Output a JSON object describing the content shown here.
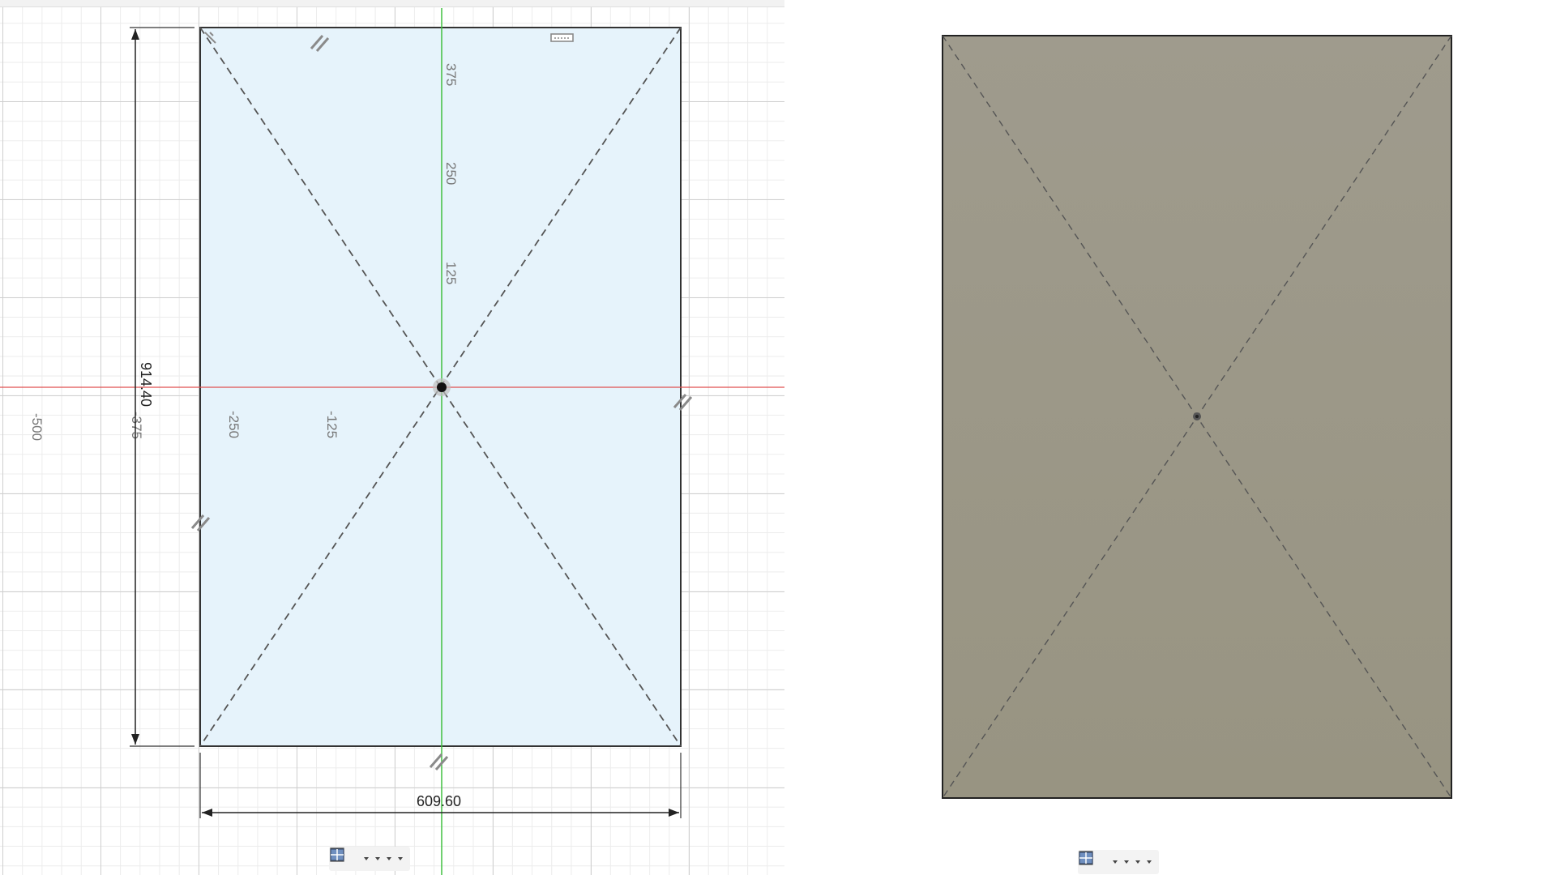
{
  "sketch_view": {
    "axis_labels": {
      "x": [
        "-500",
        "-375",
        "-250",
        "-125"
      ],
      "y": [
        "375",
        "250",
        "125"
      ]
    },
    "dimensions": {
      "height": "914.40",
      "width": "609.60"
    },
    "colors": {
      "x_axis": "#e05050",
      "y_axis": "#40c040",
      "profile_fill": "#e6f3fb"
    }
  },
  "render_view": {
    "colors": {
      "body_fill": "#9c988a"
    }
  },
  "toolbars": [
    {
      "id": "left",
      "buttons": [
        {
          "icon": "orbit-icon",
          "dropdown": true
        },
        {
          "icon": "look-at-icon",
          "dropdown": false
        },
        {
          "icon": "pan-hand-icon",
          "dropdown": false
        },
        {
          "icon": "zoom-icon",
          "dropdown": false
        },
        {
          "icon": "fit-icon",
          "dropdown": true
        },
        {
          "icon": "display-settings-icon",
          "dropdown": true
        },
        {
          "icon": "grid-snaps-icon",
          "dropdown": true
        },
        {
          "icon": "viewports-icon",
          "dropdown": true
        }
      ]
    },
    {
      "id": "right",
      "buttons": [
        {
          "icon": "orbit-icon",
          "dropdown": true
        },
        {
          "icon": "look-at-icon",
          "dropdown": false
        },
        {
          "icon": "pan-hand-icon",
          "dropdown": false
        },
        {
          "icon": "zoom-icon",
          "dropdown": false
        },
        {
          "icon": "fit-icon",
          "dropdown": true
        },
        {
          "icon": "display-settings-icon",
          "dropdown": true
        },
        {
          "icon": "grid-snaps-icon",
          "dropdown": true
        },
        {
          "icon": "viewports-icon",
          "dropdown": true
        }
      ]
    }
  ]
}
